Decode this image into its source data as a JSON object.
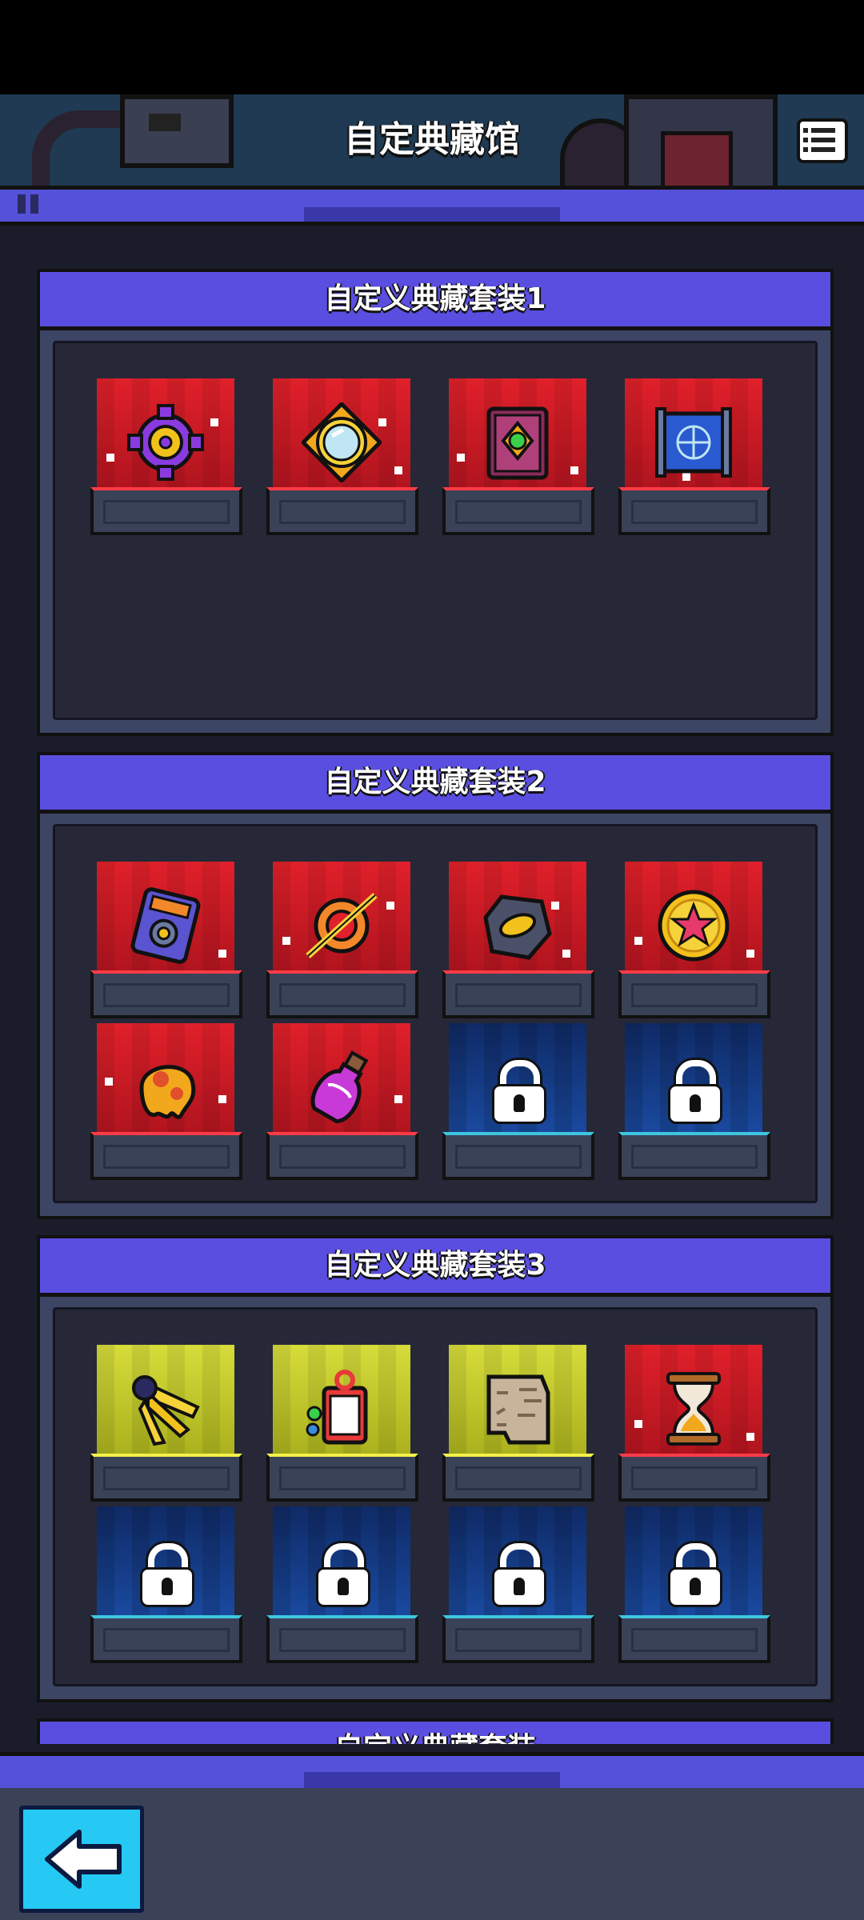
{
  "header": {
    "title": "自定典藏馆",
    "menu_icon": "list-icon"
  },
  "sets": [
    {
      "title": "自定义典藏套装1",
      "items": [
        {
          "icon": "purple-gear-icon",
          "rarity": "red",
          "locked": false
        },
        {
          "icon": "golden-mirror-icon",
          "rarity": "red",
          "locked": false
        },
        {
          "icon": "spell-book-icon",
          "rarity": "red",
          "locked": false
        },
        {
          "icon": "blueprint-scroll-icon",
          "rarity": "red",
          "locked": false
        }
      ]
    },
    {
      "title": "自定义典藏套装2",
      "items": [
        {
          "icon": "device-panel-icon",
          "rarity": "red",
          "locked": false
        },
        {
          "icon": "orange-orb-icon",
          "rarity": "red",
          "locked": false
        },
        {
          "icon": "stone-badge-icon",
          "rarity": "red",
          "locked": false
        },
        {
          "icon": "star-medal-icon",
          "rarity": "red",
          "locked": false
        },
        {
          "icon": "lava-blob-icon",
          "rarity": "red",
          "locked": false
        },
        {
          "icon": "potion-bottle-icon",
          "rarity": "red",
          "locked": false
        },
        {
          "icon": "lock-icon",
          "rarity": "blue",
          "locked": true
        },
        {
          "icon": "lock-icon",
          "rarity": "blue",
          "locked": true
        }
      ]
    },
    {
      "title": "自定义典藏套装3",
      "items": [
        {
          "icon": "yellow-claw-icon",
          "rarity": "yellow",
          "locked": false
        },
        {
          "icon": "gift-card-icon",
          "rarity": "yellow",
          "locked": false
        },
        {
          "icon": "stone-tablet-icon",
          "rarity": "yellow",
          "locked": false
        },
        {
          "icon": "hourglass-icon",
          "rarity": "red",
          "locked": false
        },
        {
          "icon": "lock-icon",
          "rarity": "blue",
          "locked": true
        },
        {
          "icon": "lock-icon",
          "rarity": "blue",
          "locked": true
        },
        {
          "icon": "lock-icon",
          "rarity": "blue",
          "locked": true
        },
        {
          "icon": "lock-icon",
          "rarity": "blue",
          "locked": true
        }
      ]
    },
    {
      "title": "自定义典藏套装",
      "items": []
    }
  ],
  "footer": {
    "back_icon": "back-arrow-icon"
  },
  "colors": {
    "panel_header": "#5a4ee0",
    "rarity_red": "#e0202a",
    "rarity_yellow": "#d6dc3a",
    "rarity_blue": "#1a4aa0",
    "back_button": "#26c8f4"
  }
}
